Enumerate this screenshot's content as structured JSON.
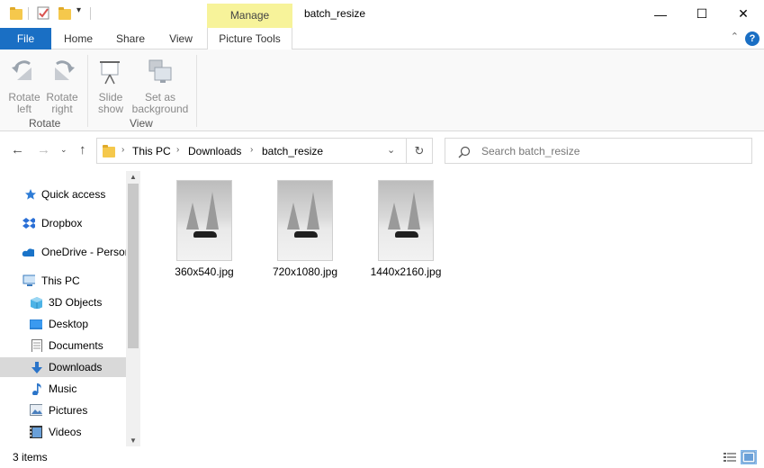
{
  "window": {
    "title": "batch_resize",
    "context_tab": "Manage",
    "minimize_glyph": "—",
    "maximize_glyph": "☐",
    "close_glyph": "✕"
  },
  "ribbon_tabs": [
    "File",
    "Home",
    "Share",
    "View",
    "Picture Tools"
  ],
  "ribbon": {
    "groups": [
      {
        "label": "Rotate",
        "buttons": [
          {
            "line1": "Rotate",
            "line2": "left",
            "icon": "rotate-left-icon"
          },
          {
            "line1": "Rotate",
            "line2": "right",
            "icon": "rotate-right-icon"
          }
        ]
      },
      {
        "label": "View",
        "buttons": [
          {
            "line1": "Slide",
            "line2": "show",
            "icon": "slideshow-icon"
          },
          {
            "line1": "Set as",
            "line2": "background",
            "icon": "set-background-icon"
          }
        ]
      }
    ]
  },
  "address": {
    "crumbs": [
      "This PC",
      "Downloads",
      "batch_resize"
    ],
    "search_placeholder": "Search batch_resize"
  },
  "nav": {
    "items": [
      {
        "label": "Quick access",
        "icon": "star-icon",
        "indent": 0
      },
      {
        "label": "Dropbox",
        "icon": "dropbox-icon",
        "indent": 0
      },
      {
        "label": "OneDrive - Person",
        "icon": "cloud-icon",
        "indent": 0
      },
      {
        "label": "This PC",
        "icon": "computer-icon",
        "indent": 0
      },
      {
        "label": "3D Objects",
        "icon": "cube-icon",
        "indent": 1
      },
      {
        "label": "Desktop",
        "icon": "desktop-icon",
        "indent": 1
      },
      {
        "label": "Documents",
        "icon": "document-icon",
        "indent": 1
      },
      {
        "label": "Downloads",
        "icon": "download-icon",
        "indent": 1,
        "selected": true
      },
      {
        "label": "Music",
        "icon": "music-icon",
        "indent": 1
      },
      {
        "label": "Pictures",
        "icon": "pictures-icon",
        "indent": 1
      },
      {
        "label": "Videos",
        "icon": "videos-icon",
        "indent": 1
      }
    ]
  },
  "files": [
    {
      "name": "360x540.jpg"
    },
    {
      "name": "720x1080.jpg"
    },
    {
      "name": "1440x2160.jpg"
    }
  ],
  "status": {
    "item_count": "3 items"
  },
  "colors": {
    "accent": "#1a6fc4",
    "manage_tab": "#f7f39a",
    "selected_nav": "#d9d9d9"
  }
}
